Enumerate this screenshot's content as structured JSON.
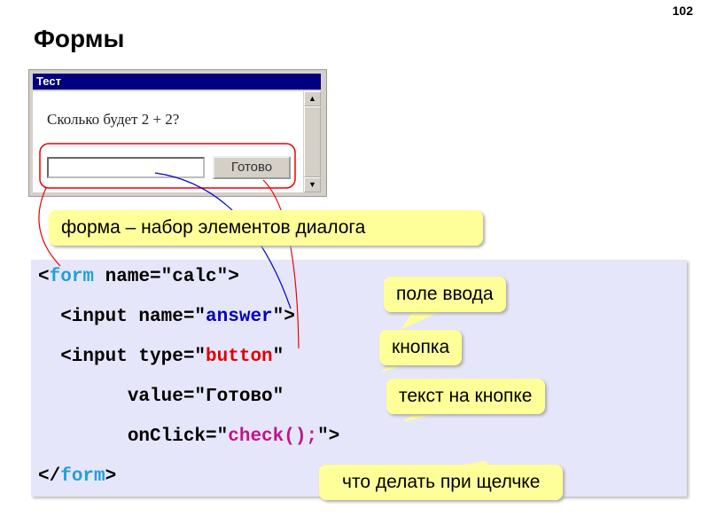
{
  "slide": {
    "page_number": "102",
    "title": "Формы"
  },
  "window": {
    "title": "Тест",
    "question": "Сколько будет 2 + 2?",
    "button_label": "Готово",
    "scroll_up": "▲",
    "scroll_down": "▼"
  },
  "code": {
    "l1": {
      "a": "<",
      "b": "form",
      "c": " name=\"calc\">"
    },
    "l2": {
      "a": "  <input name=\"",
      "b": "answer",
      "c": "\">"
    },
    "l3": {
      "a": "  <input type=\"",
      "b": "button",
      "c": "\""
    },
    "l4": {
      "a": "        value=\"Готово\""
    },
    "l5": {
      "a": "        onClick=\"",
      "b": "check();",
      "c": "\">"
    },
    "l6": {
      "a": "</",
      "b": "form",
      "c": ">"
    }
  },
  "callouts": {
    "form": "форма – набор элементов диалога",
    "input": "поле ввода",
    "button": "кнопка",
    "text": "текст на кнопке",
    "click": "что делать при щелчке"
  }
}
